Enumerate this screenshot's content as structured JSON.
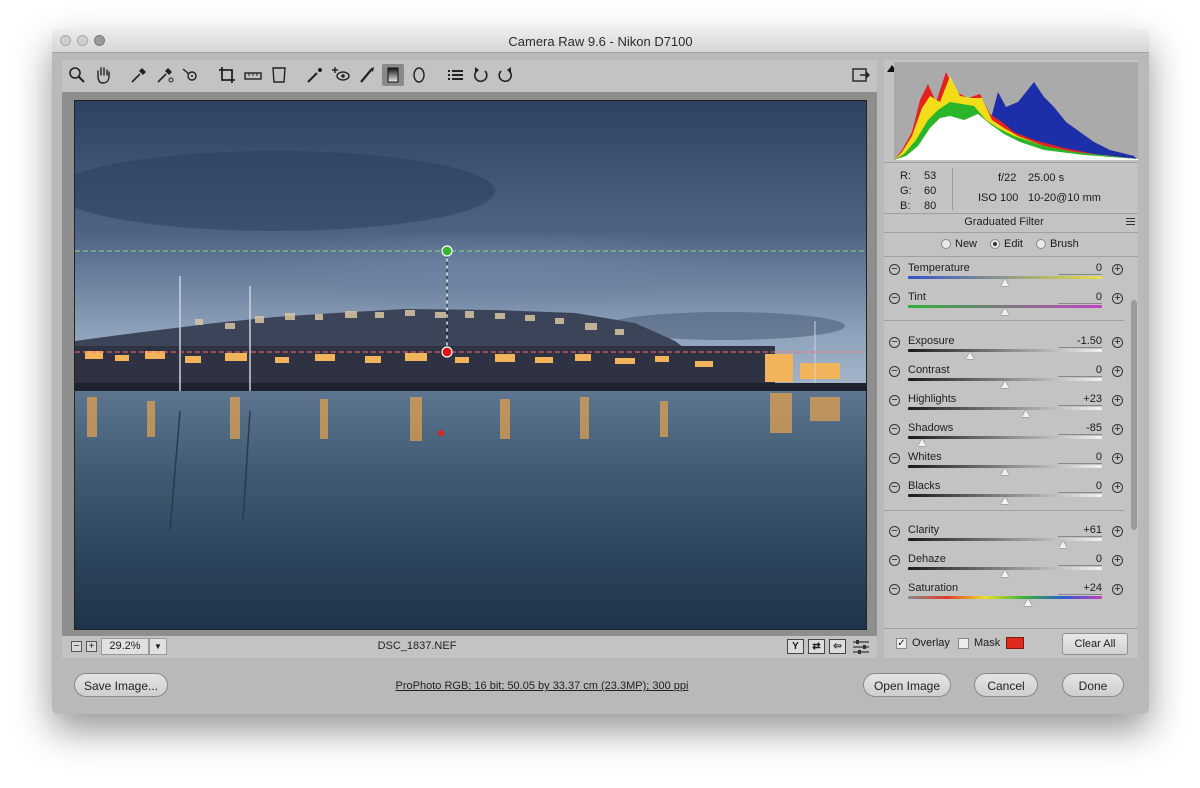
{
  "window": {
    "title": "Camera Raw 9.6  -  Nikon D7100"
  },
  "toolbar": {
    "tools": [
      "zoom-icon",
      "hand-icon",
      "white-balance-icon",
      "color-sampler-icon",
      "targeted-adjustment-icon",
      "crop-icon",
      "straighten-icon",
      "transform-icon",
      "spot-removal-icon",
      "red-eye-icon",
      "adjustment-brush-icon",
      "graduated-filter-icon",
      "radial-filter-icon",
      "preferences-icon",
      "rotate-ccw-icon",
      "rotate-cw-icon"
    ],
    "active_tool": "graduated-filter-icon"
  },
  "canvas": {
    "image_name": "Harbour at dusk with illuminated houses"
  },
  "statusbar": {
    "zoom": "29.2%",
    "filename": "DSC_1837.NEF",
    "zoom_out": "−",
    "zoom_in": "+",
    "view_btn_1": "Y",
    "view_btn_2": "⇄",
    "view_btn_3": "⇦"
  },
  "bottom": {
    "save_label": "Save Image...",
    "workflow_link": "ProPhoto RGB; 16 bit; 50.05 by 33.37 cm (23.3MP); 300 ppi",
    "open_label": "Open Image",
    "cancel_label": "Cancel",
    "done_label": "Done"
  },
  "info": {
    "r_label": "R:",
    "r": "53",
    "g_label": "G:",
    "g": "60",
    "b_label": "B:",
    "b": "80",
    "aperture": "f/22",
    "shutter": "25.00 s",
    "iso": "ISO 100",
    "lens": "10-20@10 mm"
  },
  "panel": {
    "title": "Graduated Filter",
    "modes": [
      "New",
      "Edit",
      "Brush"
    ],
    "selected_mode": "Edit",
    "sliders": [
      {
        "label": "Temperature",
        "value": "0",
        "pos": 0.5,
        "track": "temp"
      },
      {
        "label": "Tint",
        "value": "0",
        "pos": 0.5,
        "track": "tint"
      },
      {
        "label": "Exposure",
        "value": "-1.50",
        "pos": 0.32,
        "track": "gray"
      },
      {
        "label": "Contrast",
        "value": "0",
        "pos": 0.5,
        "track": "gray"
      },
      {
        "label": "Highlights",
        "value": "+23",
        "pos": 0.61,
        "track": "gray"
      },
      {
        "label": "Shadows",
        "value": "-85",
        "pos": 0.07,
        "track": "gray"
      },
      {
        "label": "Whites",
        "value": "0",
        "pos": 0.5,
        "track": "gray"
      },
      {
        "label": "Blacks",
        "value": "0",
        "pos": 0.5,
        "track": "gray"
      },
      {
        "label": "Clarity",
        "value": "+61",
        "pos": 0.8,
        "track": "gray"
      },
      {
        "label": "Dehaze",
        "value": "0",
        "pos": 0.5,
        "track": "gray"
      },
      {
        "label": "Saturation",
        "value": "+24",
        "pos": 0.62,
        "track": "sat"
      }
    ],
    "overlay_label": "Overlay",
    "overlay_checked": true,
    "mask_label": "Mask",
    "mask_checked": false,
    "mask_color": "#e12a1c",
    "clear_all_label": "Clear All"
  }
}
